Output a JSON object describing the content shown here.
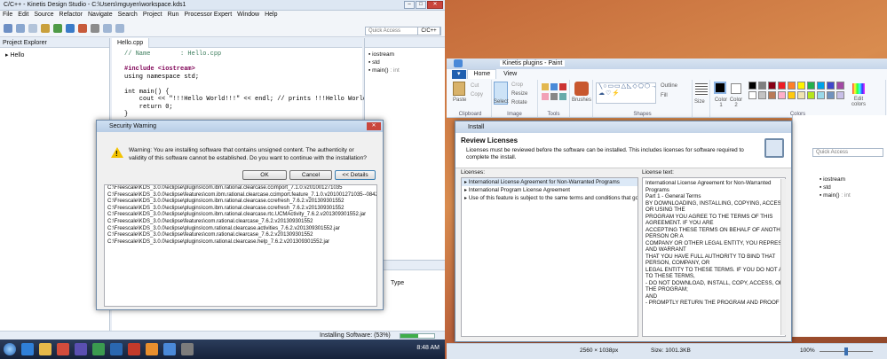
{
  "left_window": {
    "title": "C/C++ - Kinetis Design Studio - C:\\Users\\mguyen\\workspace.kds1",
    "menu": [
      "File",
      "Edit",
      "Source",
      "Refactor",
      "Navigate",
      "Search",
      "Project",
      "Run",
      "Processor Expert",
      "Window",
      "Help"
    ],
    "quick_access": "Quick Access",
    "perspective": "C/C++",
    "project_explorer": {
      "title": "Project Explorer",
      "item": "Hello"
    },
    "editor_tab": "Hello.cpp",
    "code": [
      {
        "type": "cm",
        "text": "// Name        : Hello.cpp"
      },
      {
        "type": "blank",
        "text": ""
      },
      {
        "type": "inc",
        "text": "#include <iostream>"
      },
      {
        "type": "plain",
        "text": "using namespace std;"
      },
      {
        "type": "blank",
        "text": ""
      },
      {
        "type": "plain",
        "text": "int main() {"
      },
      {
        "type": "plain",
        "text": "    cout << \"!!!Hello World!!!\" << endl; // prints !!!Hello World!!!"
      },
      {
        "type": "plain",
        "text": "    return 0;"
      },
      {
        "type": "plain",
        "text": "}"
      }
    ],
    "outline": [
      {
        "label": "iostream",
        "suffix": ""
      },
      {
        "label": "std",
        "suffix": ""
      },
      {
        "label": "main()",
        "suffix": " : int"
      }
    ],
    "bottom_column": "Type",
    "status": "Installing Software: (53%)",
    "clock": "8:48 AM"
  },
  "security_dialog": {
    "title": "Security Warning",
    "message": "Warning: You are installing software that contains unsigned content. The authenticity or validity of this software cannot be established. Do you want to continue with the installation?",
    "ok": "OK",
    "cancel": "Cancel",
    "details": "<< Details",
    "files": [
      "C:\\Freescale\\KDS_3.0.0\\eclipse\\plugins\\com.ibm.rational.clearcase.ccimport_7.1.0.v201001271035",
      "C:\\Freescale\\KDS_3.0.0\\eclipse\\features\\com.ibm.rational.clearcase.ccimport.feature_7.1.0.v201001271035--08422A2_",
      "C:\\Freescale\\KDS_3.0.0\\eclipse\\plugins\\com.ibm.rational.clearcase.ccrefresh_7.6.2.v201309301552",
      "C:\\Freescale\\KDS_3.0.0\\eclipse\\plugins\\com.ibm.rational.clearcase.ccrefresh_7.6.2.v201309301552",
      "C:\\Freescale\\KDS_3.0.0\\eclipse\\plugins\\com.ibm.rational.clearcase.rtc.UCMActivity_7.6.2.v201309301552.jar",
      "C:\\Freescale\\KDS_3.0.0\\eclipse\\features\\com.rational.clearcase_7.6.2.v201309301552",
      "C:\\Freescale\\KDS_3.0.0\\eclipse\\plugins\\com.rational.clearcase.activities_7.6.2.v201309301552.jar",
      "C:\\Freescale\\KDS_3.0.0\\eclipse\\features\\com.rational.clearcase_7.6.2.v201309301552",
      "C:\\Freescale\\KDS_3.0.0\\eclipse\\plugins\\com.rational.clearcase.help_7.6.2.v201309301552.jar"
    ]
  },
  "paint": {
    "title": "Kinetis plugins - Paint",
    "tabs": [
      "Home",
      "View"
    ],
    "groups": {
      "clipboard": "Clipboard",
      "image": "Image",
      "tools": "Tools",
      "shapes": "Shapes",
      "colors": "Colors"
    },
    "labels": {
      "paste": "Paste",
      "cut": "Cut",
      "copy": "Copy",
      "select": "Select",
      "crop": "Crop",
      "resize": "Resize",
      "rotate": "Rotate",
      "brushes": "Brushes",
      "outline": "Outline",
      "fill": "Fill",
      "size": "Size",
      "color1": "Color 1",
      "color2": "Color 2",
      "edit_colors": "Edit colors"
    },
    "swatches": [
      "#000000",
      "#7f7f7f",
      "#880015",
      "#ed1c24",
      "#ff7f27",
      "#fff200",
      "#22b14c",
      "#00a2e8",
      "#3f48cc",
      "#a349a4",
      "#ffffff",
      "#c3c3c3",
      "#b97a57",
      "#ffaec9",
      "#ffc90e",
      "#efe4b0",
      "#b5e61d",
      "#99d9ea",
      "#7092be",
      "#c8bfe7"
    ],
    "status_size": "2560 × 1038px",
    "status_file": "Size: 1001.3KB",
    "zoom": "100%"
  },
  "install": {
    "title": "Install",
    "heading": "Review Licenses",
    "description": "Licenses must be reviewed before the software can be installed.  This includes licenses for software required to complete the install.",
    "licenses_label": "Licenses:",
    "license_text_label": "License text:",
    "licenses": [
      "International License Agreement for Non-Warranted Programs",
      "International Program License Agreement",
      "Use of this feature is subject to the same terms and conditions that govern"
    ],
    "license_text": [
      "International License Agreement for Non-Warranted",
      "Programs",
      "",
      "Part 1 - General Terms",
      "",
      "BY DOWNLOADING, INSTALLING, COPYING, ACCESSING,",
      "OR USING THE",
      "PROGRAM YOU AGREE TO THE TERMS OF THIS",
      "AGREEMENT. IF YOU ARE",
      "ACCEPTING THESE TERMS ON BEHALF OF ANOTHER",
      "PERSON OR A",
      "COMPANY OR OTHER LEGAL ENTITY, YOU REPRESENT",
      "AND WARRANT",
      "THAT YOU HAVE FULL AUTHORITY TO BIND THAT",
      "PERSON, COMPANY, OR",
      "LEGAL ENTITY TO THESE TERMS. IF YOU DO NOT AGREE",
      "TO THESE TERMS,",
      "",
      "- DO NOT DOWNLOAD, INSTALL, COPY, ACCESS, OR USE",
      "THE PROGRAM;",
      "AND",
      "",
      "- PROMPTLY RETURN THE PROGRAM AND PROOF OF"
    ]
  },
  "right_eclipse": {
    "quick_access": "Quick Access",
    "outline": [
      {
        "label": "iostream",
        "suffix": ""
      },
      {
        "label": "std",
        "suffix": ""
      },
      {
        "label": "main()",
        "suffix": " : int"
      }
    ]
  }
}
